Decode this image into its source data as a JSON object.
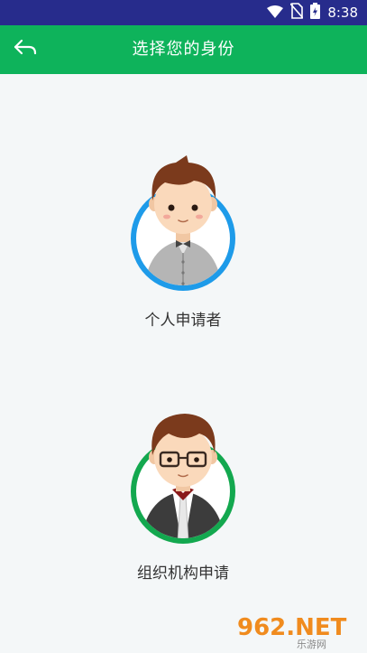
{
  "status_bar": {
    "time": "8:38",
    "icons": [
      "wifi-icon",
      "no-sim-icon",
      "battery-charging-icon"
    ]
  },
  "header": {
    "title": "选择您的身份",
    "back_icon": "back-arrow-icon"
  },
  "roles": [
    {
      "label": "个人申请者",
      "ring_color": "#1e9be9"
    },
    {
      "label": "组织机构申请",
      "ring_color": "#13a84f"
    }
  ],
  "watermark": {
    "brand": "962.NET",
    "subtitle": "乐游网"
  },
  "colors": {
    "status_bar": "#272c8c",
    "app_bar": "#0eb35b",
    "background": "#f4f7f8"
  }
}
